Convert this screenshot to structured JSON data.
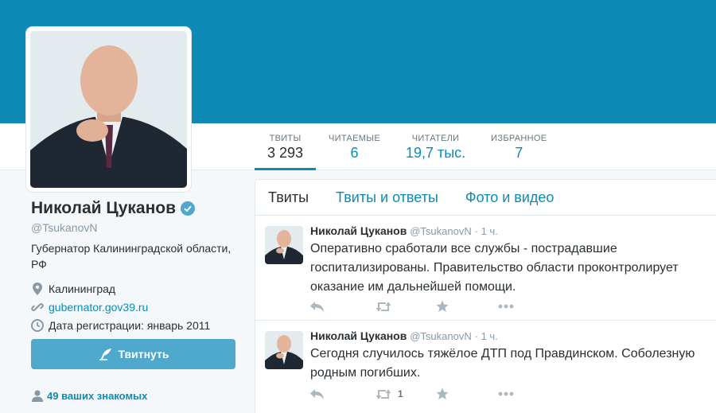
{
  "profile": {
    "name": "Николай Цуканов",
    "handle": "@TsukanovN",
    "bio": "Губернатор Калининградской области, РФ",
    "location": "Калининград",
    "website": "gubernator.gov39.ru",
    "joined": "Дата регистрации: январь 2011",
    "tweet_button": "Твитнуть",
    "followers_you_know": "49 ваших знакомых"
  },
  "stats": [
    {
      "label": "ТВИТЫ",
      "value": "3 293"
    },
    {
      "label": "ЧИТАЕМЫЕ",
      "value": "6"
    },
    {
      "label": "ЧИТАТЕЛИ",
      "value": "19,7 тыс."
    },
    {
      "label": "ИЗБРАННОЕ",
      "value": "7"
    }
  ],
  "timeline": {
    "tabs": [
      "Твиты",
      "Твиты и ответы",
      "Фото и видео"
    ],
    "tweets": [
      {
        "name": "Николай Цуканов",
        "handle": "@TsukanovN",
        "time": "· 1 ч.",
        "text": "Оперативно сработали все службы - пострадавшие госпитализированы. Правительство области проконтролирует оказание им дальнейшей помощи.",
        "retweets": ""
      },
      {
        "name": "Николай Цуканов",
        "handle": "@TsukanovN",
        "time": "· 1 ч.",
        "text": "Сегодня случилось тяжёлое ДТП под Правдинском. Соболезную родным погибших.",
        "retweets": "1"
      }
    ]
  },
  "colors": {
    "accent": "#0d8bb6",
    "tweet_button": "#4ea9cc",
    "background": "#f5f8fa",
    "icon_gray": "#aab8c2"
  }
}
